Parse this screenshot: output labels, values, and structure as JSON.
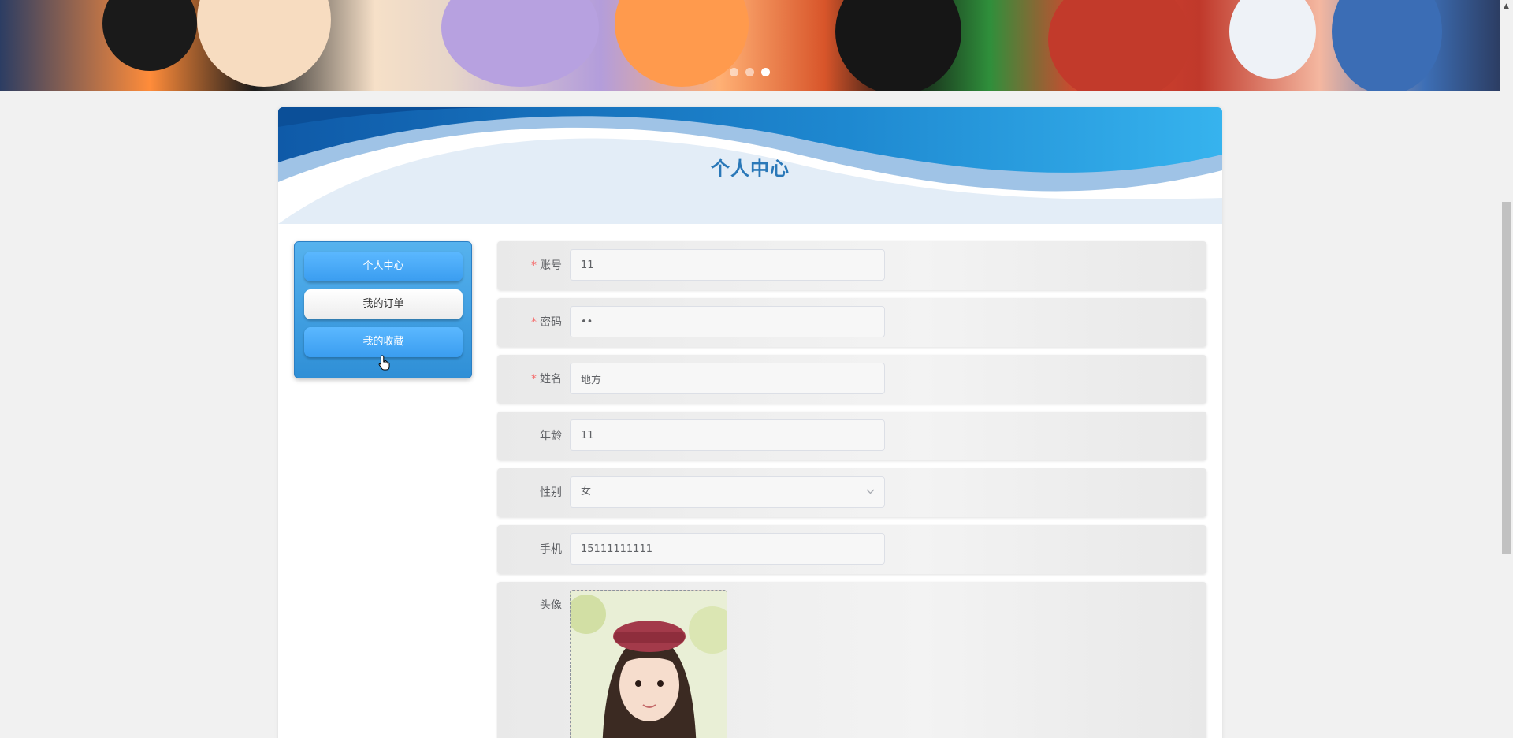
{
  "banner": {
    "slides_count": 3,
    "active_slide": 3
  },
  "page": {
    "title": "个人中心"
  },
  "menu": {
    "items": [
      {
        "label": "个人中心",
        "style": "blue"
      },
      {
        "label": "我的订单",
        "style": "white"
      },
      {
        "label": "我的收藏",
        "style": "blue"
      }
    ]
  },
  "form": {
    "account": {
      "label": "账号",
      "required": "*",
      "value": "11"
    },
    "password": {
      "label": "密码",
      "required": "*",
      "value": "••"
    },
    "name": {
      "label": "姓名",
      "required": "*",
      "value": "地方"
    },
    "age": {
      "label": "年龄",
      "value": "11"
    },
    "gender": {
      "label": "性别",
      "value": "女"
    },
    "phone": {
      "label": "手机",
      "value": "15111111111"
    },
    "avatar": {
      "label": "头像"
    }
  },
  "colors": {
    "accent_blue": "#2a78b8",
    "menu_blue": "#3a9df0",
    "required_red": "#f56c6c"
  },
  "icons": {
    "select": "chevron-down-icon",
    "cursor": "hand-pointer-icon"
  }
}
